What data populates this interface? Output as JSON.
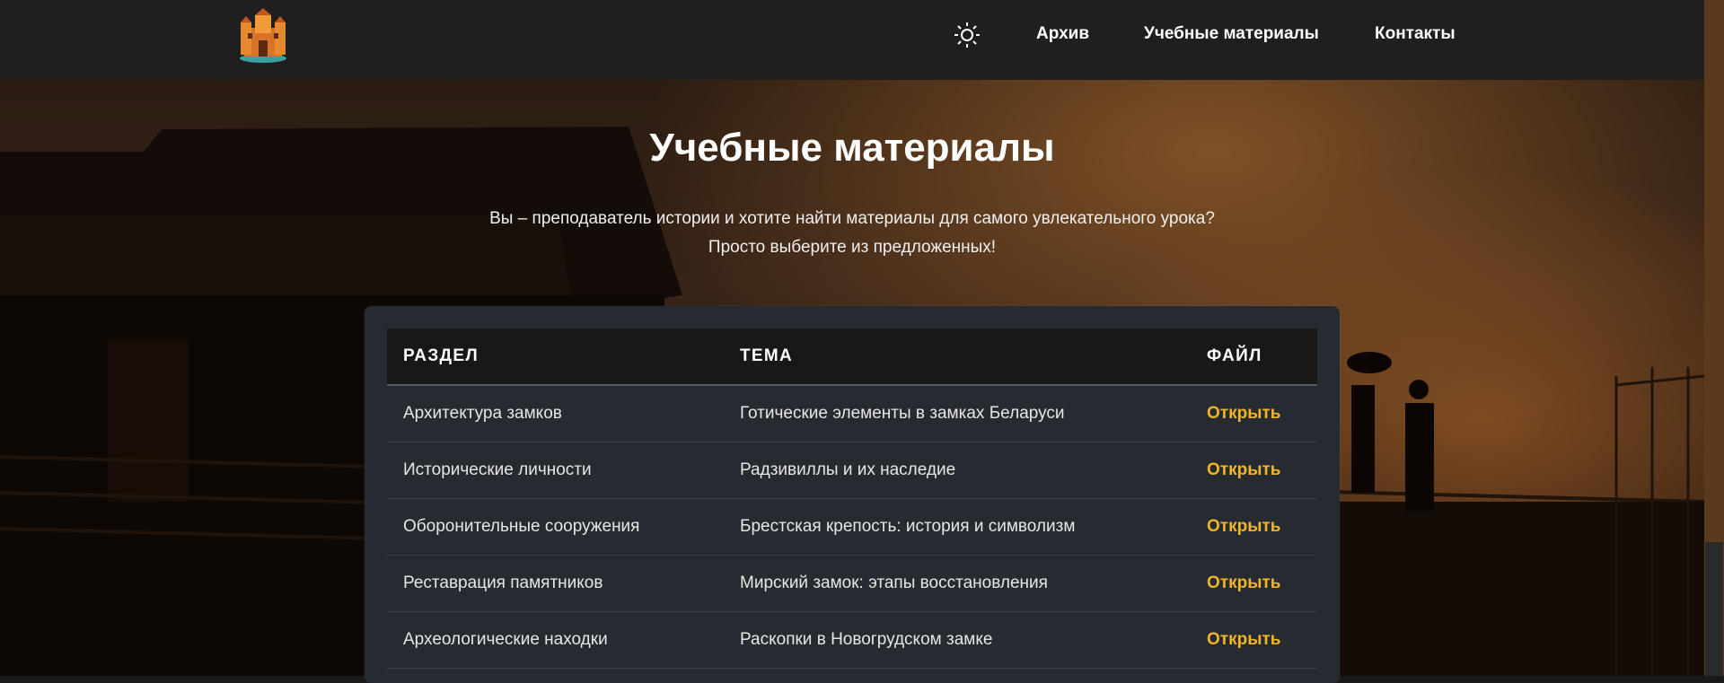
{
  "nav": {
    "logo_icon": "castle-logo-icon",
    "theme_icon": "sun-icon",
    "links": [
      "Архив",
      "Учебные материалы",
      "Контакты"
    ]
  },
  "hero": {
    "title": "Учебные материалы",
    "intro_line1": "Вы – преподаватель истории и хотите найти материалы для самого увлекательного урока?",
    "intro_line2": "Просто выберите из предложенных!"
  },
  "table": {
    "headers": [
      "РАЗДЕЛ",
      "ТЕМА",
      "ФАЙЛ"
    ],
    "rows": [
      {
        "section": "Архитектура замков",
        "topic": "Готические элементы в замках Беларуси",
        "file": "Открыть"
      },
      {
        "section": "Исторические личности",
        "topic": "Радзивиллы и их наследие",
        "file": "Открыть"
      },
      {
        "section": "Оборонительные сооружения",
        "topic": "Брестская крепость: история и символизм",
        "file": "Открыть"
      },
      {
        "section": "Реставрация памятников",
        "topic": "Мирский замок: этапы восстановления",
        "file": "Открыть"
      },
      {
        "section": "Археологические находки",
        "topic": "Раскопки в Новогрудском замке",
        "file": "Открыть"
      }
    ]
  },
  "colors": {
    "navbar_bg": "#1f1f1f",
    "panel_bg": "#262a31",
    "link_accent": "#f0b429"
  }
}
